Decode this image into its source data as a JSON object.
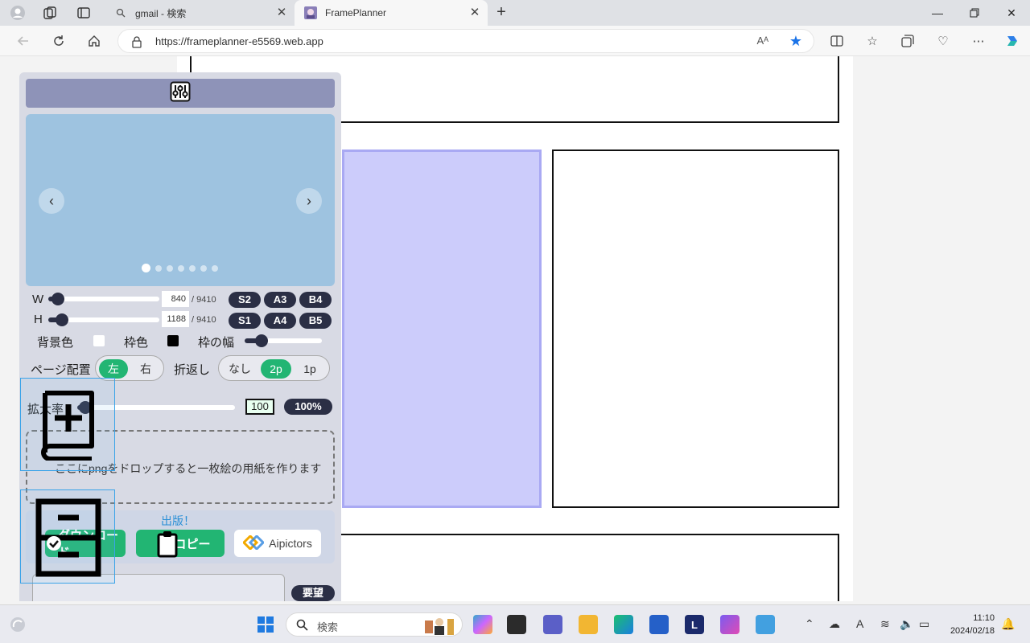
{
  "browser": {
    "tabs": [
      {
        "title": "gmail - 検索",
        "active": false
      },
      {
        "title": "FramePlanner",
        "active": true
      }
    ],
    "url": "https://frameplanner-e5569.web.app",
    "read_aloud": "Aᴬ",
    "icons": {
      "profile": "profile-icon",
      "workspaces": "workspaces-icon",
      "tab-actions": "tab-actions-icon",
      "back": "back-icon",
      "refresh": "refresh-icon",
      "home": "home-icon",
      "lock": "lock-icon",
      "favorite": "star-icon",
      "split": "split-screen-icon",
      "favorites": "favorites-icon",
      "collections": "collections-icon",
      "performance": "heart-pulse-icon",
      "more": "more-icon",
      "copilot": "copilot-icon"
    }
  },
  "panel": {
    "size": {
      "w_label": "W",
      "h_label": "H",
      "w_value": "840",
      "h_value": "1188",
      "w_max": "/ 9410",
      "h_max": "/ 9410",
      "w_fraction": 0.09,
      "h_fraction": 0.126,
      "presets_row1": [
        "S2",
        "A3",
        "B4"
      ],
      "presets_row2": [
        "S1",
        "A4",
        "B5"
      ]
    },
    "colors": {
      "bg_label": "背景色",
      "bg_color": "#ffffff",
      "frame_label": "枠色",
      "frame_color": "#000000",
      "width_label": "枠の幅",
      "width_fraction": 0.22
    },
    "layout": {
      "page_label": "ページ配置",
      "page_options": [
        "左",
        "右"
      ],
      "page_selected": "左",
      "wrap_label": "折返し",
      "wrap_options": [
        "なし",
        "2p",
        "1p"
      ],
      "wrap_selected": "2p"
    },
    "zoom": {
      "label": "拡大率",
      "value": "100",
      "percent": "100%",
      "fraction": 0.05
    },
    "dropzone_text": "ここにpngをドロップすると一枚絵の用紙を作ります",
    "publish": {
      "title": "出版！",
      "download_label": "ダウンロード",
      "copy_label": "コピー",
      "aipictors_label": "Aipictors"
    },
    "request_label": "要望"
  },
  "taskbar": {
    "search_placeholder": "検索",
    "time": "11:10",
    "date": "2024/02/18",
    "ime": "A"
  }
}
